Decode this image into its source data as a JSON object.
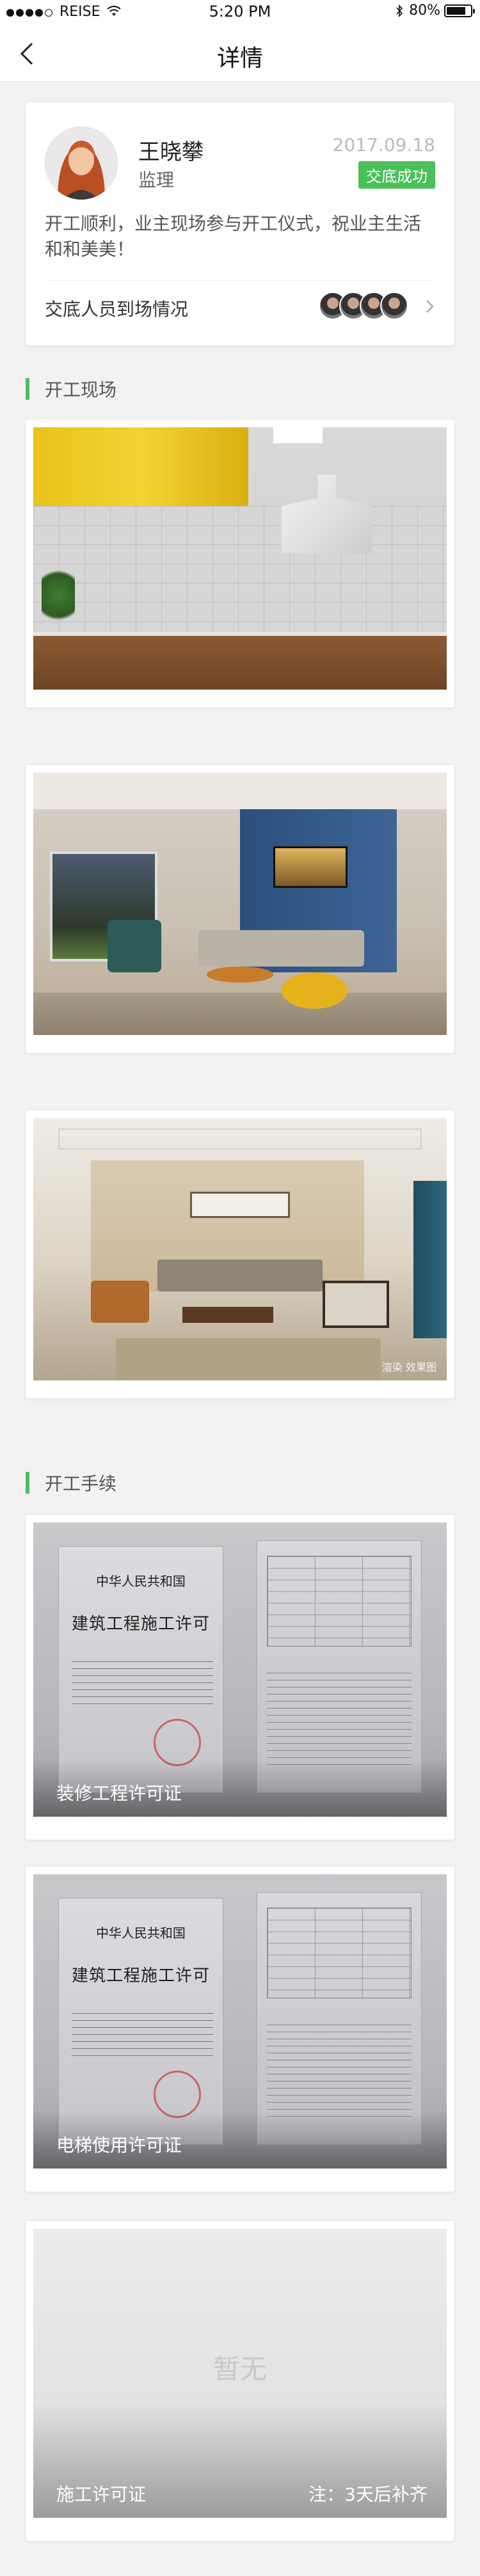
{
  "status_bar": {
    "carrier": "REISE",
    "time": "5:20 PM",
    "battery": "80%",
    "battery_level": 0.8
  },
  "nav": {
    "title": "详情",
    "back_icon": "chevron-left-icon"
  },
  "profile": {
    "name": "王晓攀",
    "role": "监理",
    "date": "2017.09.18",
    "status": "交底成功",
    "description": "开工顺利，业主现场参与开工仪式，祝业主生活和和美美！",
    "handover_label": "交底人员到场情况",
    "attendees_count": 4
  },
  "sections": {
    "site": "开工现场",
    "procedures": "开工手续"
  },
  "photos": [
    {
      "scene": "kitchen",
      "watermark": ""
    },
    {
      "scene": "living-room-blue-wall",
      "watermark": ""
    },
    {
      "scene": "living-room-beige",
      "watermark": "渲染 效果图"
    }
  ],
  "permits": [
    {
      "label": "装修工程许可证",
      "doc_country": "中华人民共和国",
      "doc_title": "建筑工程施工许可"
    },
    {
      "label": "电梯使用许可证",
      "doc_country": "中华人民共和国",
      "doc_title": "建筑工程施工许可"
    }
  ],
  "pending": {
    "empty_text": "暂无",
    "label": "施工许可证",
    "note": "注：3天后补齐"
  },
  "colors": {
    "accent_green": "#4bbf5a",
    "background": "#f2f2f2"
  }
}
